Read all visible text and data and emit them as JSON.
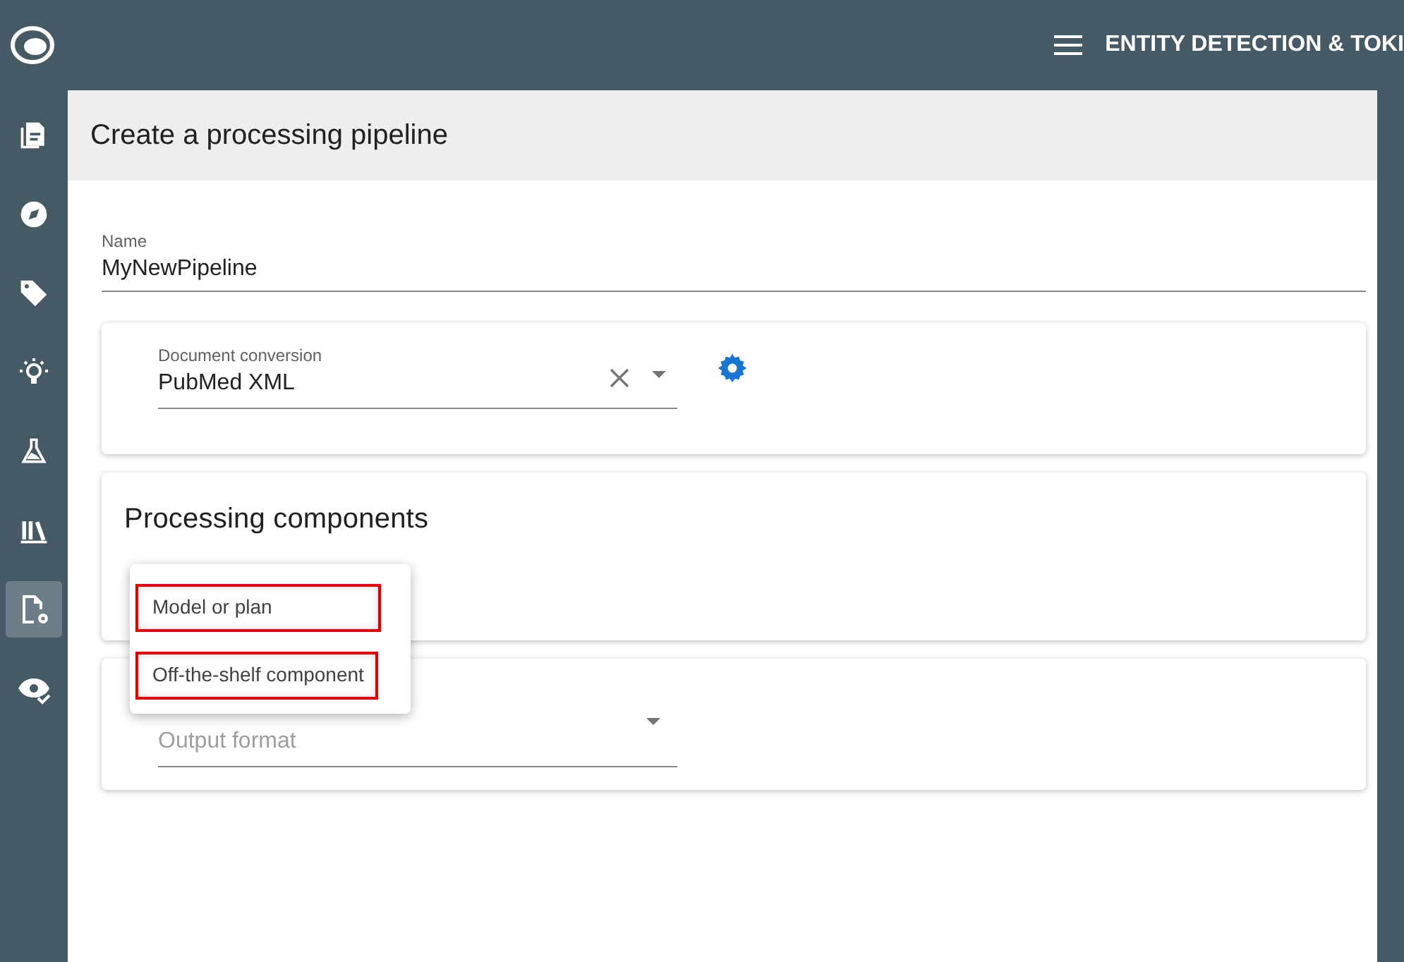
{
  "app_bar": {
    "title": "ENTITY DETECTION & TOKI"
  },
  "sidebar": {
    "items": [
      {
        "kind": "documents",
        "selected": false
      },
      {
        "kind": "compass",
        "selected": false
      },
      {
        "kind": "tag",
        "selected": false
      },
      {
        "kind": "bulb",
        "selected": false
      },
      {
        "kind": "flask",
        "selected": false
      },
      {
        "kind": "library",
        "selected": false
      },
      {
        "kind": "file-settings",
        "selected": true
      },
      {
        "kind": "eye-check",
        "selected": false
      }
    ]
  },
  "page": {
    "title": "Create a processing pipeline"
  },
  "name_field": {
    "label": "Name",
    "value": "MyNewPipeline"
  },
  "document_conversion": {
    "label": "Document conversion",
    "value": "PubMed XML"
  },
  "processing_components": {
    "heading": "Processing components"
  },
  "output": {
    "placeholder": "Output format"
  },
  "menu": {
    "items": [
      {
        "label": "Model or plan",
        "highlighted": true
      },
      {
        "label": "Off-the-shelf component",
        "highlighted": true
      }
    ]
  }
}
